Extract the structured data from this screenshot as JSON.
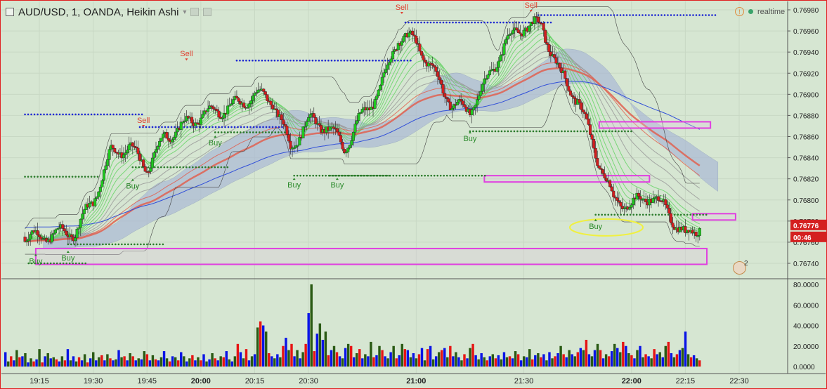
{
  "header": {
    "title": "AUD/USD, 1, OANDA, Heikin Ashi",
    "status": "realtime"
  },
  "price_tags": {
    "last_price": "0.76776",
    "countdown": "00:46"
  },
  "event_badge": "2",
  "colors": {
    "background": "#d6e6d2",
    "bull_candle": "#1fc81f",
    "bear_candle": "#d41e1e",
    "blue_line": "#1e28d2",
    "ichimoku_cloud": "#a8b6d6",
    "zone_border": "#e040e0",
    "volume_blue": "#0a14e6",
    "volume_green": "#2a5a14",
    "volume_red": "#e61414"
  },
  "chart_data": [
    {
      "type": "candlestick",
      "title": "AUD/USD, 1, OANDA, Heikin Ashi",
      "x_ticks": [
        "19:15",
        "19:30",
        "19:45",
        "20:00",
        "20:15",
        "20:30",
        "21:00",
        "21:30",
        "22:00",
        "22:15",
        "22:30"
      ],
      "y_ticks": [
        "0.76980",
        "0.76960",
        "0.76940",
        "0.76920",
        "0.76900",
        "0.76880",
        "0.76860",
        "0.76840",
        "0.76820",
        "0.76800",
        "0.76780",
        "0.76760",
        "0.76740"
      ],
      "ylim": [
        0.76728,
        0.76988
      ],
      "grid": true,
      "annotations": [
        {
          "text": "Sell",
          "time": "19:56",
          "price": 0.76932
        },
        {
          "text": "Sell",
          "time": "19:44",
          "price": 0.76869
        },
        {
          "text": "Sell",
          "time": "20:56",
          "price": 0.76976
        },
        {
          "text": "Sell",
          "time": "21:32",
          "price": 0.76978
        },
        {
          "text": "Buy",
          "time": "19:14",
          "price": 0.76749
        },
        {
          "text": "Buy",
          "time": "19:23",
          "price": 0.76752
        },
        {
          "text": "Buy",
          "time": "19:41",
          "price": 0.7682
        },
        {
          "text": "Buy",
          "time": "20:04",
          "price": 0.76861
        },
        {
          "text": "Buy",
          "time": "20:26",
          "price": 0.76821
        },
        {
          "text": "Buy",
          "time": "20:38",
          "price": 0.76821
        },
        {
          "text": "Buy",
          "time": "21:15",
          "price": 0.76865
        },
        {
          "text": "Buy",
          "time": "21:50",
          "price": 0.76782
        }
      ],
      "zones": [
        {
          "from": "19:14",
          "to": "22:21",
          "high": 0.76754,
          "low": 0.76739
        },
        {
          "from": "21:51",
          "to": "22:22",
          "high": 0.76874,
          "low": 0.76868
        },
        {
          "from": "21:19",
          "to": "22:05",
          "high": 0.76823,
          "low": 0.76817
        },
        {
          "from": "22:17",
          "to": "22:29",
          "high": 0.76787,
          "low": 0.76781
        }
      ],
      "ohlc_approx": [
        {
          "time": "19:15",
          "close": 0.76765
        },
        {
          "time": "19:20",
          "close": 0.76768
        },
        {
          "time": "19:25",
          "close": 0.7677
        },
        {
          "time": "19:30",
          "close": 0.768
        },
        {
          "time": "19:35",
          "close": 0.76845
        },
        {
          "time": "19:40",
          "close": 0.7685
        },
        {
          "time": "19:45",
          "close": 0.7683
        },
        {
          "time": "19:50",
          "close": 0.7686
        },
        {
          "time": "19:55",
          "close": 0.7687
        },
        {
          "time": "20:00",
          "close": 0.7688
        },
        {
          "time": "20:05",
          "close": 0.76885
        },
        {
          "time": "20:10",
          "close": 0.7689
        },
        {
          "time": "20:15",
          "close": 0.769
        },
        {
          "time": "20:20",
          "close": 0.76895
        },
        {
          "time": "20:25",
          "close": 0.7685
        },
        {
          "time": "20:30",
          "close": 0.76875
        },
        {
          "time": "20:35",
          "close": 0.7687
        },
        {
          "time": "20:40",
          "close": 0.7685
        },
        {
          "time": "20:45",
          "close": 0.7688
        },
        {
          "time": "20:50",
          "close": 0.76905
        },
        {
          "time": "20:55",
          "close": 0.76955
        },
        {
          "time": "21:00",
          "close": 0.7695
        },
        {
          "time": "21:05",
          "close": 0.7692
        },
        {
          "time": "21:10",
          "close": 0.7689
        },
        {
          "time": "21:15",
          "close": 0.76885
        },
        {
          "time": "21:20",
          "close": 0.76915
        },
        {
          "time": "21:25",
          "close": 0.7695
        },
        {
          "time": "21:30",
          "close": 0.76965
        },
        {
          "time": "21:35",
          "close": 0.76965
        },
        {
          "time": "21:40",
          "close": 0.7692
        },
        {
          "time": "21:45",
          "close": 0.76895
        },
        {
          "time": "21:50",
          "close": 0.76845
        },
        {
          "time": "21:55",
          "close": 0.768
        },
        {
          "time": "22:00",
          "close": 0.76795
        },
        {
          "time": "22:05",
          "close": 0.76805
        },
        {
          "time": "22:10",
          "close": 0.7679
        },
        {
          "time": "22:15",
          "close": 0.76765
        },
        {
          "time": "22:19",
          "close": 0.76776
        }
      ]
    },
    {
      "type": "bar",
      "title": "",
      "y_ticks": [
        "80.0000",
        "60.0000",
        "40.0000",
        "20.0000",
        "0.0000"
      ],
      "ylim": [
        0,
        80
      ],
      "series": [
        {
          "values": [
            14,
            5,
            10,
            6,
            16,
            9,
            10,
            13,
            4,
            8,
            5,
            7,
            17,
            4,
            10,
            13,
            8,
            9,
            7,
            5,
            10,
            6,
            17,
            6,
            10,
            5,
            9,
            6,
            12,
            4,
            8,
            14,
            6,
            9,
            11,
            6,
            12,
            8,
            6,
            7,
            16,
            9,
            10,
            6,
            13,
            10,
            6,
            8,
            7,
            15,
            12,
            6,
            11,
            7,
            6,
            9,
            15,
            8,
            5,
            10,
            9,
            6,
            14,
            10,
            5,
            8,
            11,
            6,
            9,
            6,
            12,
            5,
            7,
            13,
            8,
            6,
            10,
            9,
            15,
            7,
            5,
            10,
            22,
            14,
            8,
            17,
            6,
            10,
            12,
            38,
            44,
            40,
            34,
            13,
            10,
            8,
            12,
            9,
            20,
            28,
            16,
            22,
            10,
            16,
            8,
            14,
            22,
            52,
            80,
            15,
            32,
            42,
            26,
            34,
            11,
            16,
            20,
            14,
            10,
            8,
            18,
            22,
            20,
            9,
            13,
            17,
            8,
            12,
            10,
            24,
            9,
            11,
            20,
            16,
            10,
            8,
            14,
            20,
            8,
            11,
            22,
            17,
            16,
            9,
            13,
            8,
            12,
            18,
            6,
            17,
            20,
            7,
            10,
            14,
            16,
            18,
            9,
            20,
            10,
            14,
            9,
            6,
            12,
            8,
            18,
            22,
            11,
            7,
            13,
            9,
            6,
            10,
            12,
            8,
            11,
            7,
            14,
            9,
            10,
            8,
            15,
            12,
            6,
            10,
            9,
            17,
            7,
            11,
            13,
            9,
            12,
            6,
            14,
            8,
            10,
            13,
            20,
            12,
            9,
            16,
            12,
            10,
            14,
            18,
            16,
            26,
            12,
            10,
            16,
            22,
            16,
            8,
            12,
            10,
            15,
            22,
            18,
            14,
            24,
            20,
            13,
            11,
            8,
            16,
            20,
            9,
            12,
            10,
            8,
            17,
            12,
            14,
            9,
            20,
            24,
            13,
            9,
            12,
            16,
            18,
            34,
            12,
            9,
            11,
            8,
            6
          ]
        }
      ]
    }
  ]
}
